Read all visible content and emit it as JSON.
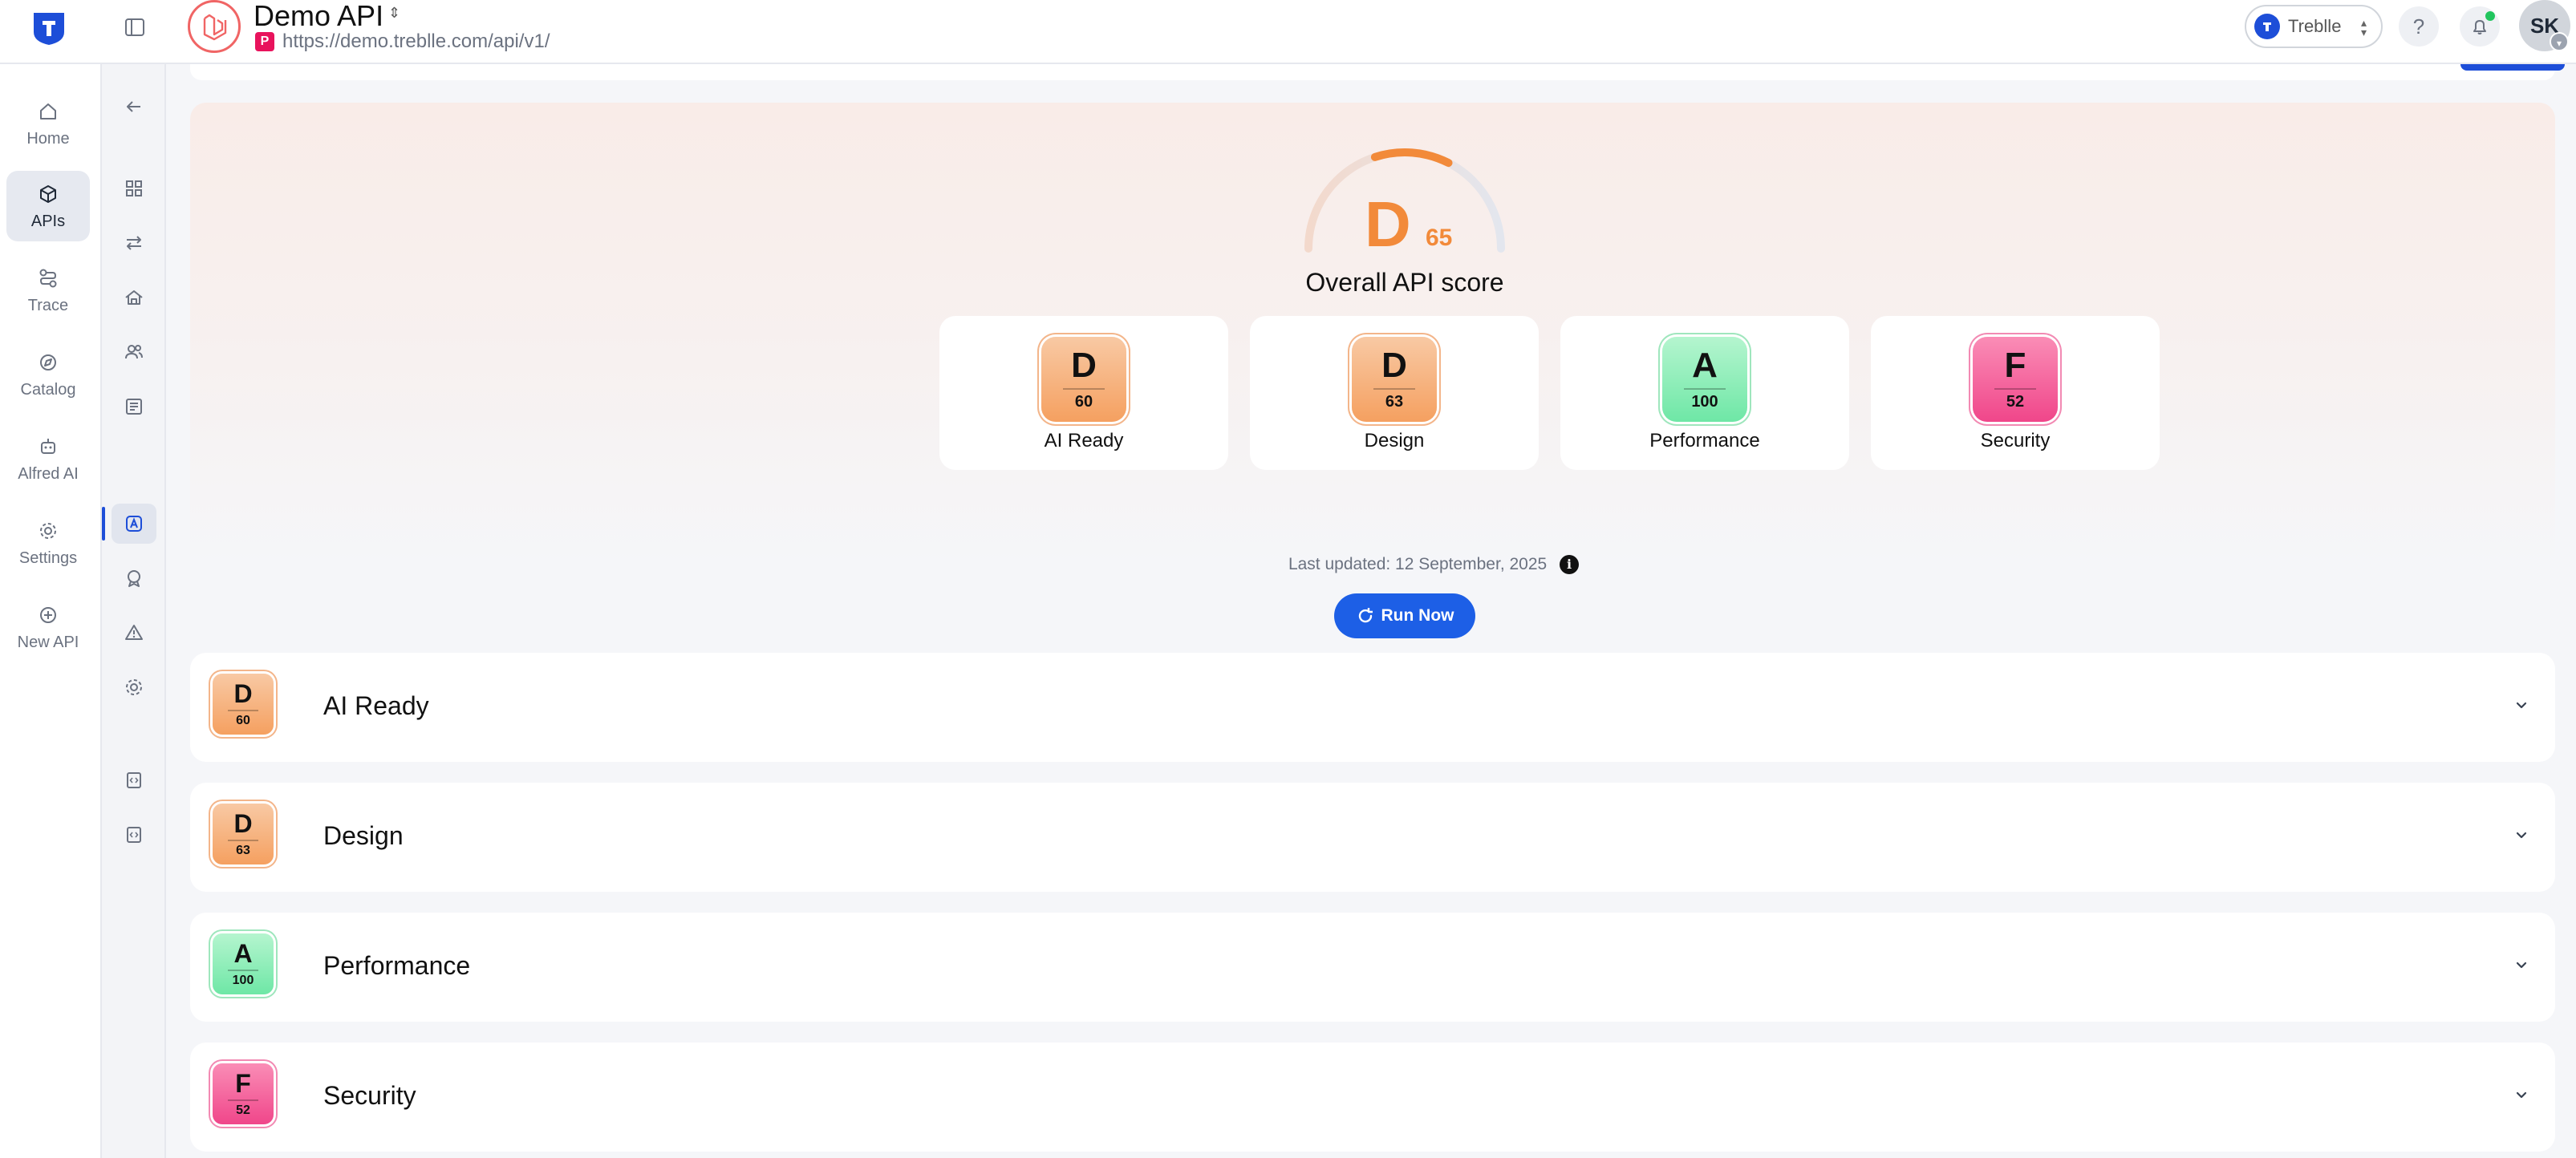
{
  "header": {
    "api_name": "Demo API",
    "api_url_badge": "P",
    "api_url": "https://demo.treblle.com/api/v1/",
    "workspace": "Treblle",
    "help": "?",
    "user_initials": "SK"
  },
  "nav": {
    "items": [
      {
        "label": "Home",
        "icon": "home-icon"
      },
      {
        "label": "APIs",
        "icon": "apis-icon",
        "active": true
      },
      {
        "label": "Trace",
        "icon": "trace-icon"
      },
      {
        "label": "Catalog",
        "icon": "catalog-icon"
      },
      {
        "label": "Alfred AI",
        "icon": "robot-icon"
      },
      {
        "label": "Settings",
        "icon": "gear-icon"
      },
      {
        "label": "New API",
        "icon": "plus-circle-icon"
      }
    ]
  },
  "overall": {
    "grade": "D",
    "score": "65",
    "score_fraction": 0.65,
    "label": "Overall API score",
    "color": "#f28a3a"
  },
  "categories": [
    {
      "name": "AI Ready",
      "grade": "D",
      "score": "60"
    },
    {
      "name": "Design",
      "grade": "D",
      "score": "63"
    },
    {
      "name": "Performance",
      "grade": "A",
      "score": "100"
    },
    {
      "name": "Security",
      "grade": "F",
      "score": "52"
    }
  ],
  "last_updated": "Last updated: 12 September, 2025",
  "info_icon": "i",
  "run_button": "Run Now",
  "sections": [
    {
      "title": "AI Ready",
      "grade": "D",
      "score": "60"
    },
    {
      "title": "Design",
      "grade": "D",
      "score": "63"
    },
    {
      "title": "Performance",
      "grade": "A",
      "score": "100"
    },
    {
      "title": "Security",
      "grade": "F",
      "score": "52"
    }
  ],
  "colors": {
    "accent": "#1d5fe6",
    "grade_d": "#f5a060",
    "grade_a": "#6ee7a6",
    "grade_f": "#f0468a"
  }
}
